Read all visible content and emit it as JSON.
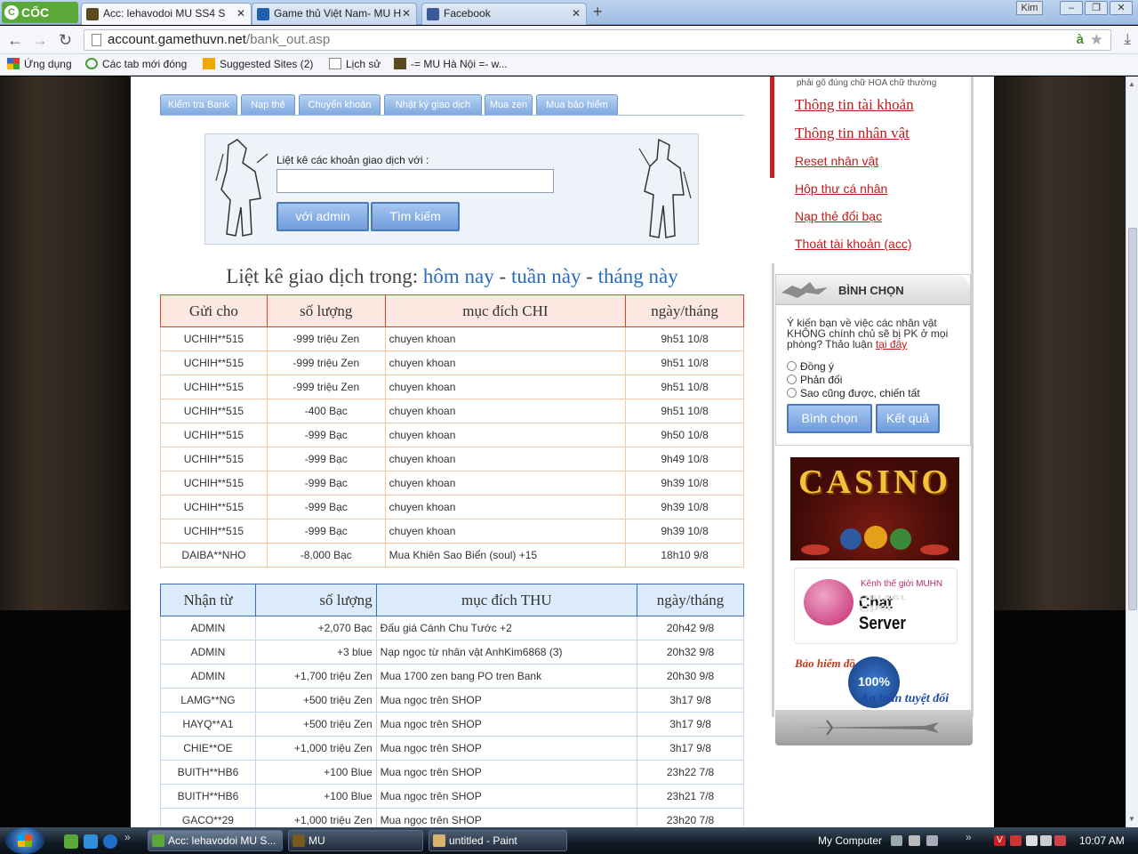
{
  "browser": {
    "logo": "CỐC CỐC",
    "tabs": [
      {
        "label": "Acc: lehavodoi MU SS4 S"
      },
      {
        "label": "Game thủ Việt Nam- MU H"
      },
      {
        "label": "Facebook"
      }
    ],
    "new_tab": "+",
    "user": "Kim",
    "url_host": "account.gamethuvn.net",
    "url_path": "/bank_out.asp",
    "bookmarks": [
      "Ứng dụng",
      "Các tab mới đóng",
      "Suggested Sites (2)",
      "Lịch sử",
      "-= MU Hà Nội =- w..."
    ]
  },
  "menu_tabs": [
    "Kiểm tra Bank",
    "Nạp thẻ",
    "Chuyển khoản",
    "Nhật ký giao dịch",
    "Mua zen",
    "Mua bảo hiểm"
  ],
  "search": {
    "label": "Liệt kê các khoản giao dịch với :",
    "value": "",
    "btn_admin": "với admin",
    "btn_search": "Tìm kiếm"
  },
  "listing": {
    "prefix": "Liệt kê giao dịch trong:",
    "today": "hôm nay",
    "sep": "-",
    "week": "tuần này",
    "month": "tháng này"
  },
  "send_table": {
    "headers": [
      "Gửi cho",
      "số lượng",
      "mục đích CHI",
      "ngày/tháng"
    ],
    "rows": [
      [
        "UCHIH**515",
        "-999  triệu Zen",
        "chuyen khoan",
        "9h51 10/8"
      ],
      [
        "UCHIH**515",
        "-999  triệu Zen",
        "chuyen khoan",
        "9h51 10/8"
      ],
      [
        "UCHIH**515",
        "-999  triệu Zen",
        "chuyen khoan",
        "9h51 10/8"
      ],
      [
        "UCHIH**515",
        "-400  Bạc",
        "chuyen khoan",
        "9h51 10/8"
      ],
      [
        "UCHIH**515",
        "-999  Bạc",
        "chuyen khoan",
        "9h50 10/8"
      ],
      [
        "UCHIH**515",
        "-999  Bạc",
        "chuyen khoan",
        "9h49 10/8"
      ],
      [
        "UCHIH**515",
        "-999  Bạc",
        "chuyen khoan",
        "9h39 10/8"
      ],
      [
        "UCHIH**515",
        "-999  Bạc",
        "chuyen khoan",
        "9h39 10/8"
      ],
      [
        "UCHIH**515",
        "-999  Bạc",
        "chuyen khoan",
        "9h39 10/8"
      ],
      [
        "DAIBA**NHO",
        "-8,000  Bạc",
        "Mua Khiên Sao Biển (soul) +15",
        "18h10 9/8"
      ]
    ]
  },
  "recv_table": {
    "headers": [
      "Nhận từ",
      "số lượng",
      "mục đích THU",
      "ngày/tháng"
    ],
    "rows": [
      [
        "ADMIN",
        "+2,070  Bạc",
        "Đấu giá Cánh Chu Tước +2",
        "20h42 9/8"
      ],
      [
        "ADMIN",
        "+3  blue",
        "Nạp ngọc từ nhân vật AnhKim6868 (3)",
        "20h32 9/8"
      ],
      [
        "ADMIN",
        "+1,700  triệu Zen",
        "Mua 1700 zen bang PO tren Bank",
        "20h30 9/8"
      ],
      [
        "LAMG**NG",
        "+500  triệu Zen",
        "Mua ngọc trên SHOP",
        "3h17 9/8"
      ],
      [
        "HAYQ**A1",
        "+500  triệu Zen",
        "Mua ngọc trên SHOP",
        "3h17 9/8"
      ],
      [
        "CHIE**OE",
        "+1,000  triệu Zen",
        "Mua ngọc trên SHOP",
        "3h17 9/8"
      ],
      [
        "BUITH**HB6",
        "+100  Blue",
        "Mua ngọc trên SHOP",
        "23h22 7/8"
      ],
      [
        "BUITH**HB6",
        "+100  Blue",
        "Mua ngọc trên SHOP",
        "23h21 7/8"
      ],
      [
        "GACO**29",
        "+1,000  triệu Zen",
        "Mua ngọc trên SHOP",
        "23h20 7/8"
      ]
    ]
  },
  "sidebar": {
    "hint": "phải gõ đúng chữ HOA chữ thường",
    "links": [
      "Thông tin tài khoản",
      "Thông tin nhân vật",
      "Reset nhân vật",
      "Hộp thư cá nhân",
      "Nạp thẻ đổi bạc",
      "Thoát tài khoản (acc)"
    ]
  },
  "vote": {
    "title": "BÌNH CHỌN",
    "question": "Ý kiến bạn về việc các nhân vật KHÔNG chính chủ sẽ bị PK ở mọi phòng? Thảo luận",
    "link": "tại đây",
    "options": [
      "Đồng ý",
      "Phản đối",
      "Sao cũng được, chiến tất"
    ],
    "btn_vote": "Bình chọn",
    "btn_result": "Kết quả"
  },
  "ads": {
    "casino": "CASINO",
    "chat_top": "Kênh thế giới MUHN",
    "chat_main": "Chat Server",
    "insurance_top": "Bảo hiểm đồ",
    "insurance_pct": "100%",
    "insurance_bottom": "An toàn tuyệt đối"
  },
  "taskbar": {
    "windows": [
      "Acc: lehavodoi MU S...",
      "MU",
      "untitled - Paint"
    ],
    "computer": "My Computer",
    "clock": "10:07 AM"
  }
}
